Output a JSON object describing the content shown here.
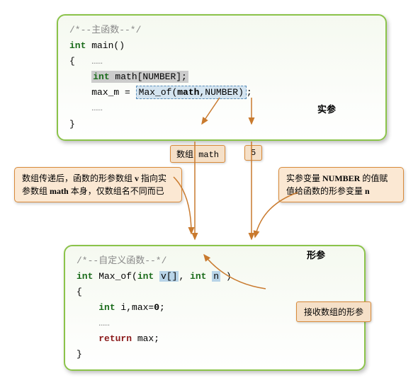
{
  "box1": {
    "comment": "/*--主函数--*/",
    "sig": "int main()",
    "decl": "int math[NUMBER];",
    "assign_lhs": "max_m = ",
    "call_fn": "Max_of",
    "call_a1": "math",
    "call_a2": "NUMBER",
    "actual_label": "实参"
  },
  "chips": {
    "arr": "数组 math",
    "n": "5"
  },
  "note_left": "数组传递后，函数的形参数组 v 指向实参数组 math 本身，仅数组名不同而已",
  "note_right": "实参变量 NUMBER 的值赋值给函数的形参变量 n",
  "box2": {
    "comment": "/*--自定义函数--*/",
    "formal_label": "形参",
    "sig_pre": "int Max_of(int ",
    "p1": "v[]",
    "sig_mid": ", int ",
    "p2": "n",
    "sig_post": " )",
    "l1": "int i,max=0;",
    "ret": "return max;"
  },
  "note_bottom": "接收数组的形参"
}
